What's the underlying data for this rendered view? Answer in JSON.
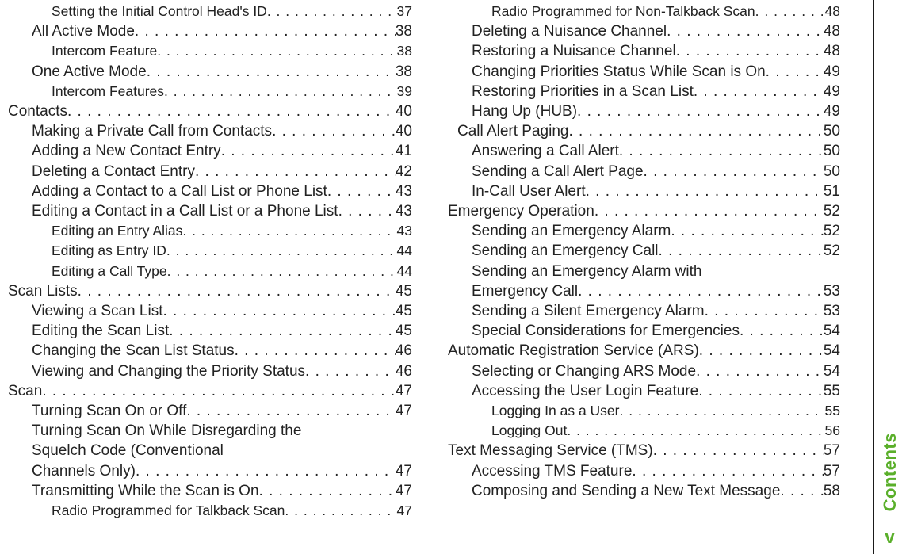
{
  "sidebar": {
    "label": "Contents",
    "page": "v"
  },
  "left": [
    {
      "lvl": 2,
      "title": "Setting the Initial Control Head's ID",
      "page": "37"
    },
    {
      "lvl": 1,
      "title": "All Active Mode",
      "page": "38"
    },
    {
      "lvl": 2,
      "title": "Intercom Feature",
      "page": "38"
    },
    {
      "lvl": 1,
      "title": "One Active Mode",
      "page": "38"
    },
    {
      "lvl": 2,
      "title": "Intercom Features",
      "page": "39"
    },
    {
      "lvl": 0,
      "title": "Contacts",
      "page": "40"
    },
    {
      "lvl": 1,
      "title": "Making a Private Call from Contacts",
      "page": "40"
    },
    {
      "lvl": 1,
      "title": "Adding a New Contact Entry",
      "page": "41"
    },
    {
      "lvl": 1,
      "title": "Deleting a Contact Entry",
      "page": "42"
    },
    {
      "lvl": 1,
      "title": "Adding a Contact to a Call List or Phone List",
      "page": "43"
    },
    {
      "lvl": 1,
      "title": "Editing a Contact in a Call List or a Phone List",
      "page": "43"
    },
    {
      "lvl": 2,
      "title": "Editing an Entry Alias",
      "page": "43"
    },
    {
      "lvl": 2,
      "title": "Editing as Entry ID",
      "page": "44"
    },
    {
      "lvl": 2,
      "title": "Editing a Call Type",
      "page": "44"
    },
    {
      "lvl": 0,
      "title": "Scan Lists",
      "page": "45"
    },
    {
      "lvl": 1,
      "title": "Viewing a Scan List",
      "page": "45"
    },
    {
      "lvl": 1,
      "title": "Editing the Scan List",
      "page": "45"
    },
    {
      "lvl": 1,
      "title": "Changing the Scan List Status",
      "page": "46"
    },
    {
      "lvl": 1,
      "title": "Viewing and Changing the Priority Status",
      "page": "46"
    },
    {
      "lvl": 0,
      "title": "Scan",
      "page": "47"
    },
    {
      "lvl": 1,
      "title": "Turning Scan On or Off",
      "page": "47"
    },
    {
      "lvl": 1,
      "wrap": [
        "Turning Scan On While Disregarding the",
        "Squelch Code (Conventional",
        "Channels Only)"
      ],
      "page": "47"
    },
    {
      "lvl": 1,
      "title": "Transmitting While the Scan is On",
      "page": "47"
    },
    {
      "lvl": 2,
      "title": "Radio Programmed for Talkback Scan",
      "page": "47"
    }
  ],
  "right": [
    {
      "lvl": 2,
      "title": "Radio Programmed for Non-Talkback Scan",
      "page": "48"
    },
    {
      "lvl": 1,
      "title": "Deleting a Nuisance Channel",
      "page": "48"
    },
    {
      "lvl": 1,
      "title": "Restoring a Nuisance Channel",
      "page": "48"
    },
    {
      "lvl": 1,
      "title": "Changing Priorities Status While Scan is On",
      "page": "49"
    },
    {
      "lvl": 1,
      "title": "Restoring Priorities in a Scan List",
      "page": "49"
    },
    {
      "lvl": 1,
      "title": "Hang Up (HUB)",
      "page": "49"
    },
    {
      "lvl": 0,
      "title": "Call Alert Paging",
      "page": "50",
      "indent": true
    },
    {
      "lvl": 1,
      "title": "Answering a Call Alert",
      "page": "50"
    },
    {
      "lvl": 1,
      "title": "Sending a Call Alert Page",
      "page": "50"
    },
    {
      "lvl": 1,
      "title": "In-Call User Alert",
      "page": "51"
    },
    {
      "lvl": 0,
      "title": "Emergency Operation",
      "page": "52"
    },
    {
      "lvl": 1,
      "title": "Sending an Emergency Alarm",
      "page": "52"
    },
    {
      "lvl": 1,
      "title": "Sending an Emergency Call",
      "page": "52"
    },
    {
      "lvl": 1,
      "wrap": [
        "Sending an Emergency Alarm with",
        "Emergency Call"
      ],
      "page": "53"
    },
    {
      "lvl": 1,
      "title": "Sending a Silent Emergency Alarm",
      "page": "53"
    },
    {
      "lvl": 1,
      "title": "Special Considerations for Emergencies",
      "page": "54"
    },
    {
      "lvl": 0,
      "title": "Automatic Registration Service (ARS)",
      "page": "54"
    },
    {
      "lvl": 1,
      "title": "Selecting or Changing ARS Mode",
      "page": "54"
    },
    {
      "lvl": 1,
      "title": "Accessing the User Login Feature",
      "page": "55"
    },
    {
      "lvl": 2,
      "title": "Logging In as a User",
      "page": "55"
    },
    {
      "lvl": 2,
      "title": "Logging Out",
      "page": "56"
    },
    {
      "lvl": 0,
      "title": "Text Messaging Service (TMS)",
      "page": "57"
    },
    {
      "lvl": 1,
      "title": "Accessing TMS Feature",
      "page": "57"
    },
    {
      "lvl": 1,
      "title": "Composing and Sending a New Text Message",
      "page": "58"
    }
  ]
}
